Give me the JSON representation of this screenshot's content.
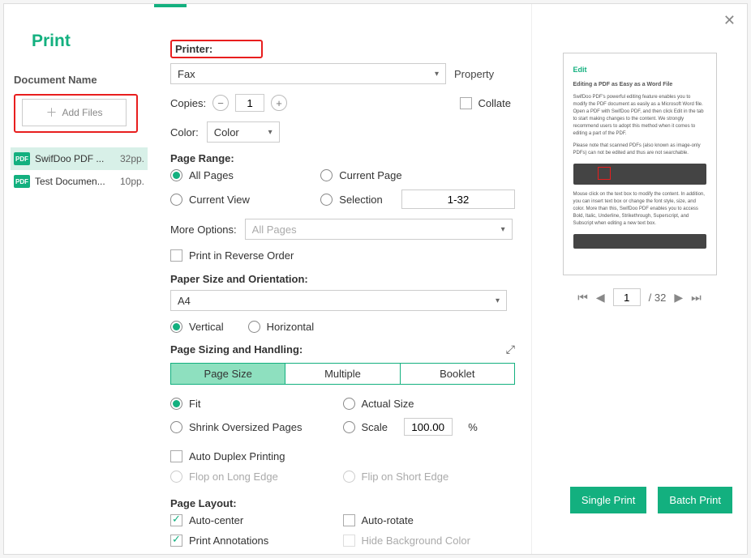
{
  "dialog": {
    "title": "Print",
    "close": "✕"
  },
  "sidebar": {
    "docLabel": "Document Name",
    "addFiles": "Add Files",
    "docs": [
      {
        "icon": "PDF",
        "name": "SwifDoo PDF ...",
        "pages": "32pp."
      },
      {
        "icon": "PDF",
        "name": "Test Documen...",
        "pages": "10pp."
      }
    ]
  },
  "printer": {
    "label": "Printer:",
    "selected": "Fax",
    "property": "Property",
    "copiesLabel": "Copies:",
    "copies": "1",
    "collate": "Collate",
    "colorLabel": "Color:",
    "color": "Color"
  },
  "pageRange": {
    "label": "Page Range:",
    "all": "All Pages",
    "current": "Current Page",
    "view": "Current View",
    "selection": "Selection",
    "range": "1-32",
    "moreLabel": "More Options:",
    "more": "All Pages",
    "reverse": "Print in Reverse Order"
  },
  "paper": {
    "label": "Paper Size and Orientation:",
    "size": "A4",
    "vertical": "Vertical",
    "horizontal": "Horizontal"
  },
  "sizing": {
    "label": "Page Sizing and Handling:",
    "tabs": [
      "Page Size",
      "Multiple",
      "Booklet"
    ],
    "fit": "Fit",
    "actual": "Actual Size",
    "shrink": "Shrink Oversized Pages",
    "scale": "Scale",
    "scaleVal": "100.00",
    "pct": "%"
  },
  "duplex": {
    "auto": "Auto Duplex Printing",
    "long": "Flop on Long Edge",
    "short": "Flip on Short Edge"
  },
  "layout": {
    "label": "Page Layout:",
    "center": "Auto-center",
    "rotate": "Auto-rotate",
    "annot": "Print Annotations",
    "hidebg": "Hide Background Color"
  },
  "preview": {
    "title": "Edit",
    "sub": "Editing a PDF as Easy as a Word File",
    "page": "1",
    "total": "/ 32"
  },
  "actions": {
    "single": "Single Print",
    "batch": "Batch Print"
  }
}
